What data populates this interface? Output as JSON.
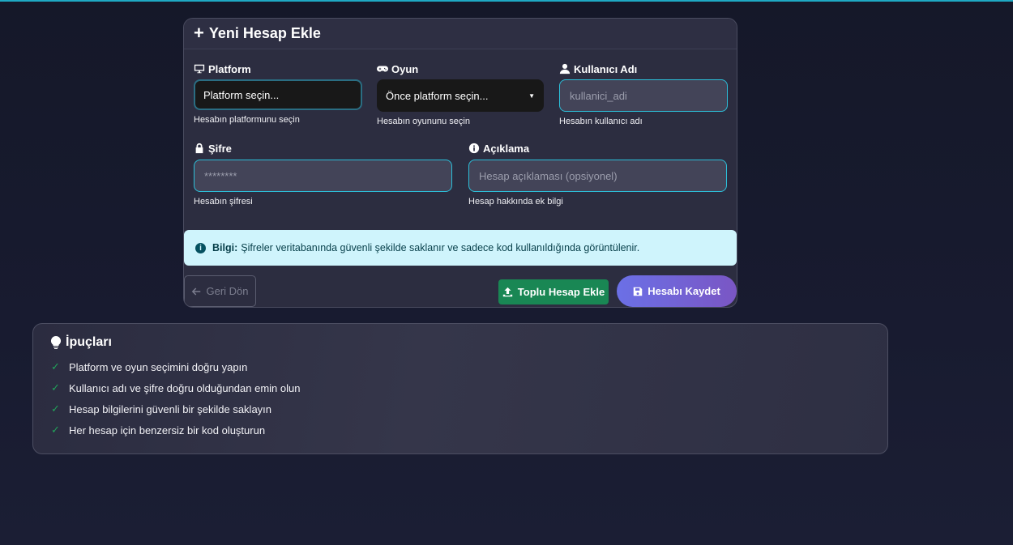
{
  "card": {
    "title": "Yeni Hesap Ekle",
    "platform": {
      "label": "Platform",
      "value": "Platform seçin...",
      "help": "Hesabın platformunu seçin"
    },
    "game": {
      "label": "Oyun",
      "value": "Önce platform seçin...",
      "help": "Hesabın oyununu seçin"
    },
    "username": {
      "label": "Kullanıcı Adı",
      "placeholder": "kullanici_adi",
      "help": "Hesabın kullanıcı adı"
    },
    "password": {
      "label": "Şifre",
      "placeholder": "********",
      "help": "Hesabın şifresi"
    },
    "description": {
      "label": "Açıklama",
      "placeholder": "Hesap açıklaması (opsiyonel)",
      "help": "Hesap hakkında ek bilgi"
    },
    "info": {
      "strong": "Bilgi:",
      "text": "Şifreler veritabanında güvenli şekilde saklanır ve sadece kod kullanıldığında görüntülenir."
    },
    "buttons": {
      "back": "Geri Dön",
      "bulk": "Toplu Hesap Ekle",
      "save": "Hesabı Kaydet"
    }
  },
  "tips": {
    "title": "İpuçları",
    "items": [
      "Platform ve oyun seçimini doğru yapın",
      "Kullanıcı adı ve şifre doğru olduğundan emin olun",
      "Hesap bilgilerini güvenli bir şekilde saklayın",
      "Her hesap için benzersiz bir kod oluşturun"
    ]
  },
  "colors": {
    "accent": "#2cbfd9",
    "success": "#198754",
    "info_bg": "#cff4fc",
    "save_gradient_start": "#6b70e6",
    "save_gradient_end": "#7a56c4"
  }
}
